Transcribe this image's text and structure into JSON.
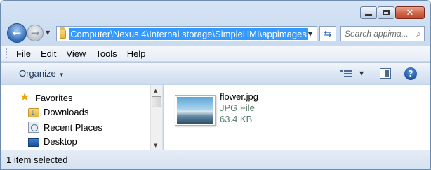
{
  "window": {
    "caption_buttons": {
      "minimize": "—",
      "maximize": "□",
      "close": "✕"
    }
  },
  "address": {
    "path": "Computer\\Nexus 4\\Internal storage\\SimpleHMI\\appimages",
    "search_placeholder": "Search appima..."
  },
  "menu": {
    "items": [
      {
        "accel": "F",
        "rest": "ile"
      },
      {
        "accel": "E",
        "rest": "dit"
      },
      {
        "accel": "V",
        "rest": "iew"
      },
      {
        "accel": "T",
        "rest": "ools"
      },
      {
        "accel": "H",
        "rest": "elp"
      }
    ]
  },
  "commandbar": {
    "organize_label": "Organize",
    "help_label": "?"
  },
  "navigation": {
    "items": [
      {
        "label": "Favorites",
        "icon": "star-icon"
      },
      {
        "label": "Downloads",
        "icon": "downloads-folder-icon"
      },
      {
        "label": "Recent Places",
        "icon": "recent-places-icon"
      },
      {
        "label": "Desktop",
        "icon": "desktop-icon"
      }
    ]
  },
  "files": [
    {
      "name": "flower.jpg",
      "type": "JPG File",
      "size": "63.4 KB"
    }
  ],
  "status": {
    "text": "1 item selected"
  }
}
